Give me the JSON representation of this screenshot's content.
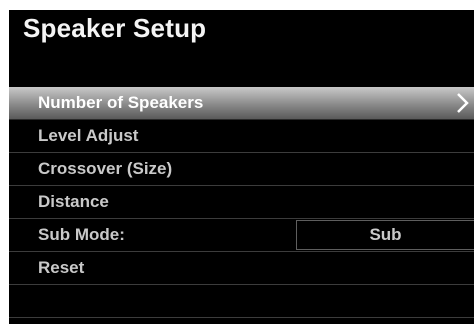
{
  "title": "Speaker Setup",
  "menu": {
    "items": [
      {
        "label": "Number of Speakers",
        "selected": true,
        "has_submenu": true
      },
      {
        "label": "Level Adjust"
      },
      {
        "label": "Crossover (Size)"
      },
      {
        "label": "Distance"
      },
      {
        "label": "Sub Mode:",
        "value": "Sub"
      },
      {
        "label": "Reset"
      }
    ]
  },
  "icons": {
    "selected_item": "chevron-right-icon"
  },
  "colors": {
    "background": "#000000",
    "title_text": "#f4f4f4",
    "item_text": "#c9c9c9",
    "selected_text": "#ffffff",
    "highlight_top": "#c9c9c9",
    "highlight_bottom": "#5a5a5a"
  }
}
